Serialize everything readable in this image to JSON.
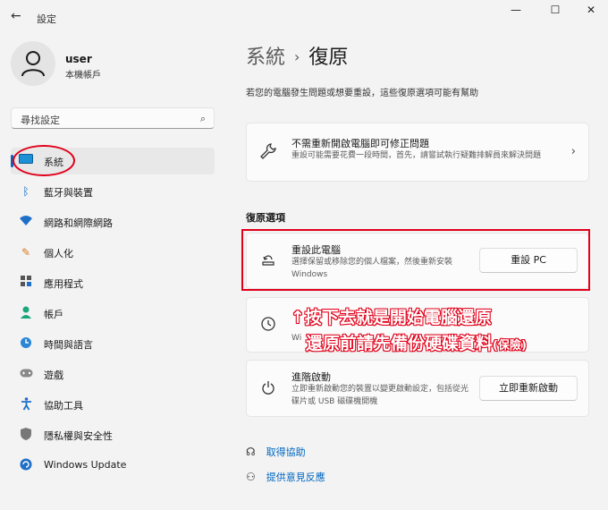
{
  "titlebar": {
    "back_glyph": "←",
    "title": "設定",
    "minimize_glyph": "—",
    "maximize_glyph": "☐",
    "close_glyph": "✕"
  },
  "profile": {
    "name": "user",
    "subtitle": "本機帳戶"
  },
  "search": {
    "placeholder": "尋找設定",
    "icon": "search-icon"
  },
  "sidebar": {
    "accent": "#0067c0",
    "items": [
      {
        "label": "系統",
        "icon": "monitor-icon",
        "active": true
      },
      {
        "label": "藍牙與裝置",
        "icon": "bluetooth-icon"
      },
      {
        "label": "網路和網際網路",
        "icon": "wifi-icon"
      },
      {
        "label": "個人化",
        "icon": "brush-icon"
      },
      {
        "label": "應用程式",
        "icon": "apps-icon"
      },
      {
        "label": "帳戶",
        "icon": "person-icon"
      },
      {
        "label": "時間與語言",
        "icon": "globe-clock-icon"
      },
      {
        "label": "遊戲",
        "icon": "gamepad-icon"
      },
      {
        "label": "協助工具",
        "icon": "accessibility-icon"
      },
      {
        "label": "隱私權與安全性",
        "icon": "shield-icon"
      },
      {
        "label": "Windows Update",
        "icon": "update-icon"
      }
    ]
  },
  "main": {
    "breadcrumb_parent": "系統",
    "breadcrumb_sep": "›",
    "breadcrumb_current": "復原",
    "description": "若您的電腦發生問題或想要重設，這些復原選項可能有幫助",
    "fix_card": {
      "title": "不需重新開啟電腦即可修正問題",
      "desc": "重設可能需要花費一段時間，首先，請嘗試執行疑難排解員來解決問題",
      "icon": "wrench-icon",
      "chevron": "›"
    },
    "section_header": "復原選項",
    "reset_card": {
      "title": "重設此電腦",
      "desc": "選擇保留或移除您的個人檔案，然後重新安裝 Windows",
      "button": "重設 PC",
      "icon": "reset-pc-icon"
    },
    "goback_card": {
      "desc_fragment": "Wi",
      "icon": "history-icon"
    },
    "advanced_card": {
      "title": "進階啟動",
      "desc": "立即重新啟動您的裝置以變更啟動設定，包括從光碟片或 USB 磁碟機開機",
      "button": "立即重新啟動",
      "icon": "advanced-startup-icon"
    },
    "links": [
      {
        "label": "取得協助",
        "icon": "help-icon"
      },
      {
        "label": "提供意見反應",
        "icon": "feedback-icon"
      }
    ]
  },
  "annotations": {
    "line1": "↑按下去就是開始電腦還原",
    "line2": "還原前請先備份硬碟資料",
    "line2_suffix": "(保險)",
    "color": "#e0001a"
  }
}
